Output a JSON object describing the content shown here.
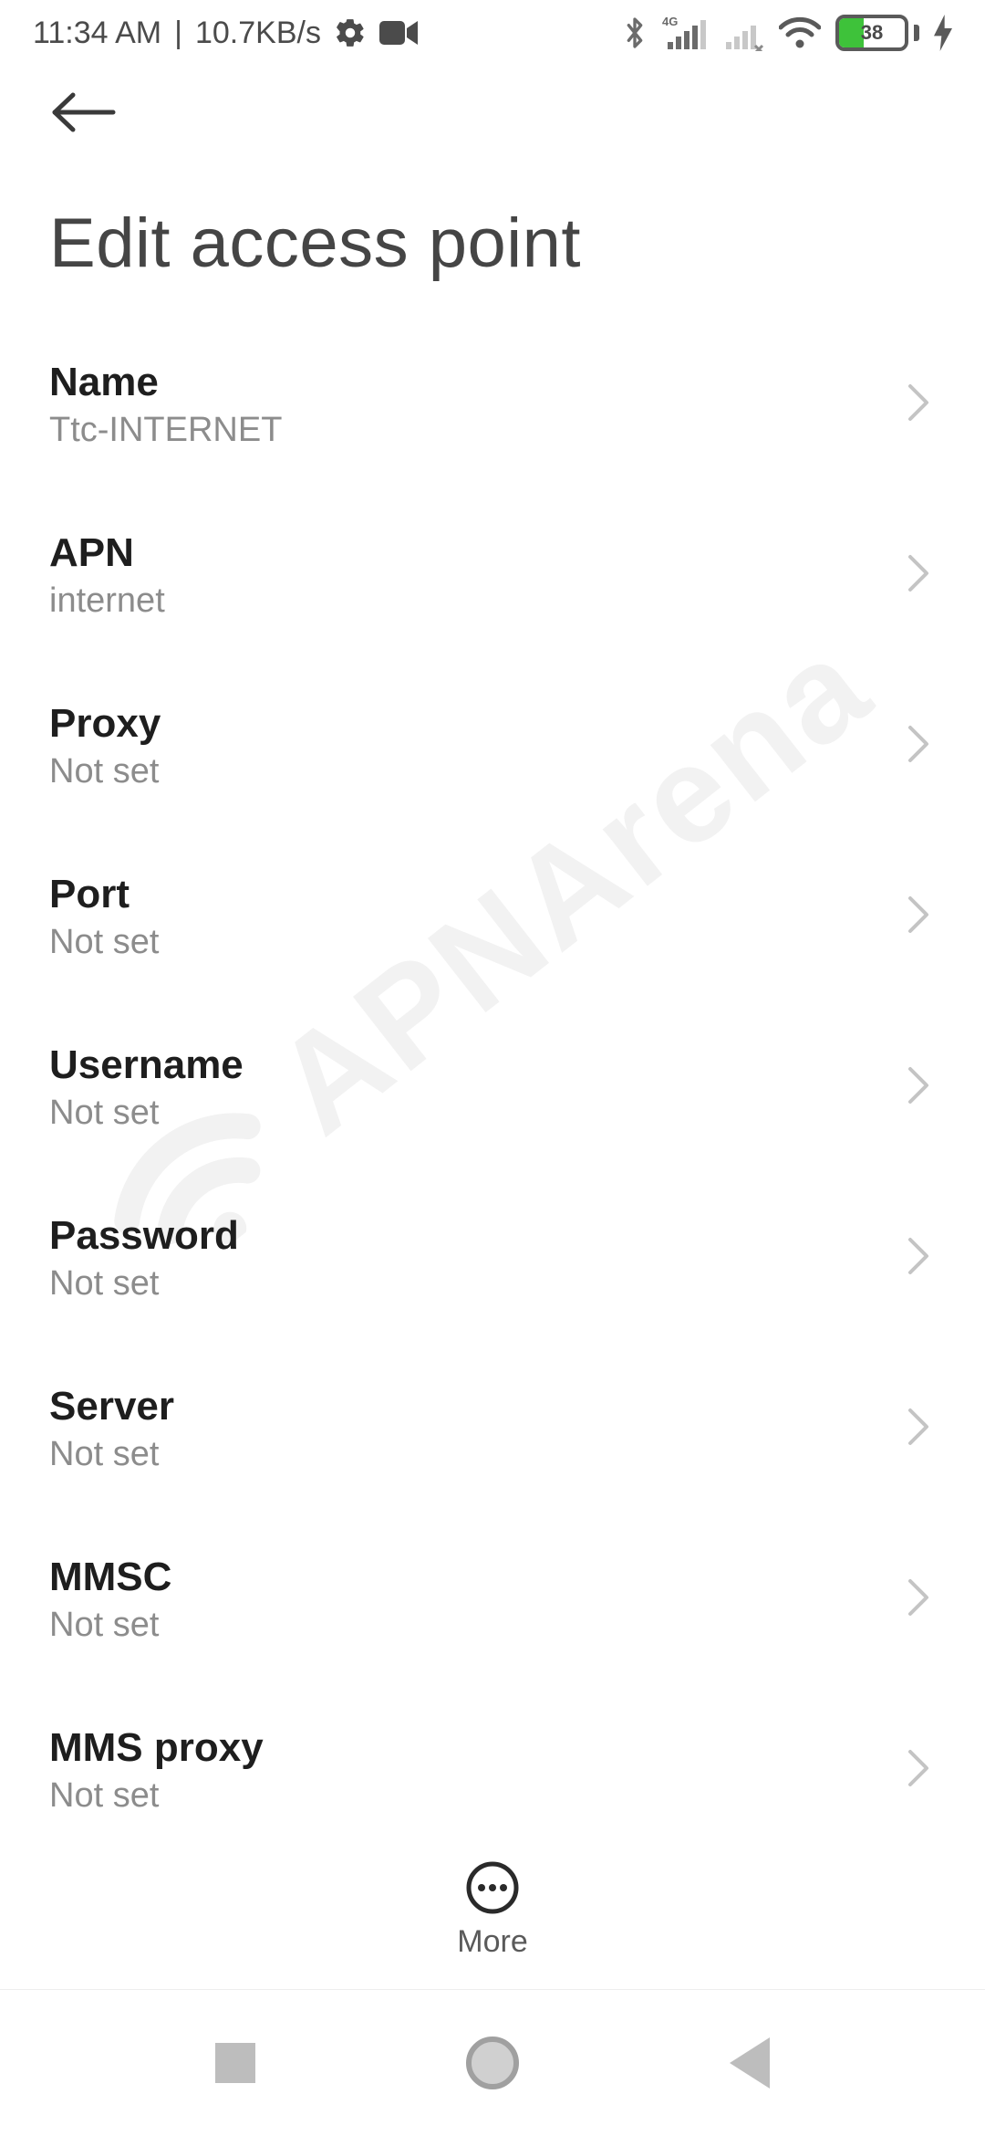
{
  "status": {
    "time": "11:34 AM",
    "separator": "|",
    "netspeed": "10.7KB/s",
    "battery_pct": "38"
  },
  "appbar": {
    "title": "Edit access point"
  },
  "items": [
    {
      "label": "Name",
      "value": "Ttc-INTERNET"
    },
    {
      "label": "APN",
      "value": "internet"
    },
    {
      "label": "Proxy",
      "value": "Not set"
    },
    {
      "label": "Port",
      "value": "Not set"
    },
    {
      "label": "Username",
      "value": "Not set"
    },
    {
      "label": "Password",
      "value": "Not set"
    },
    {
      "label": "Server",
      "value": "Not set"
    },
    {
      "label": "MMSC",
      "value": "Not set"
    },
    {
      "label": "MMS proxy",
      "value": "Not set"
    }
  ],
  "more_label": "More",
  "watermark": "APNArena"
}
